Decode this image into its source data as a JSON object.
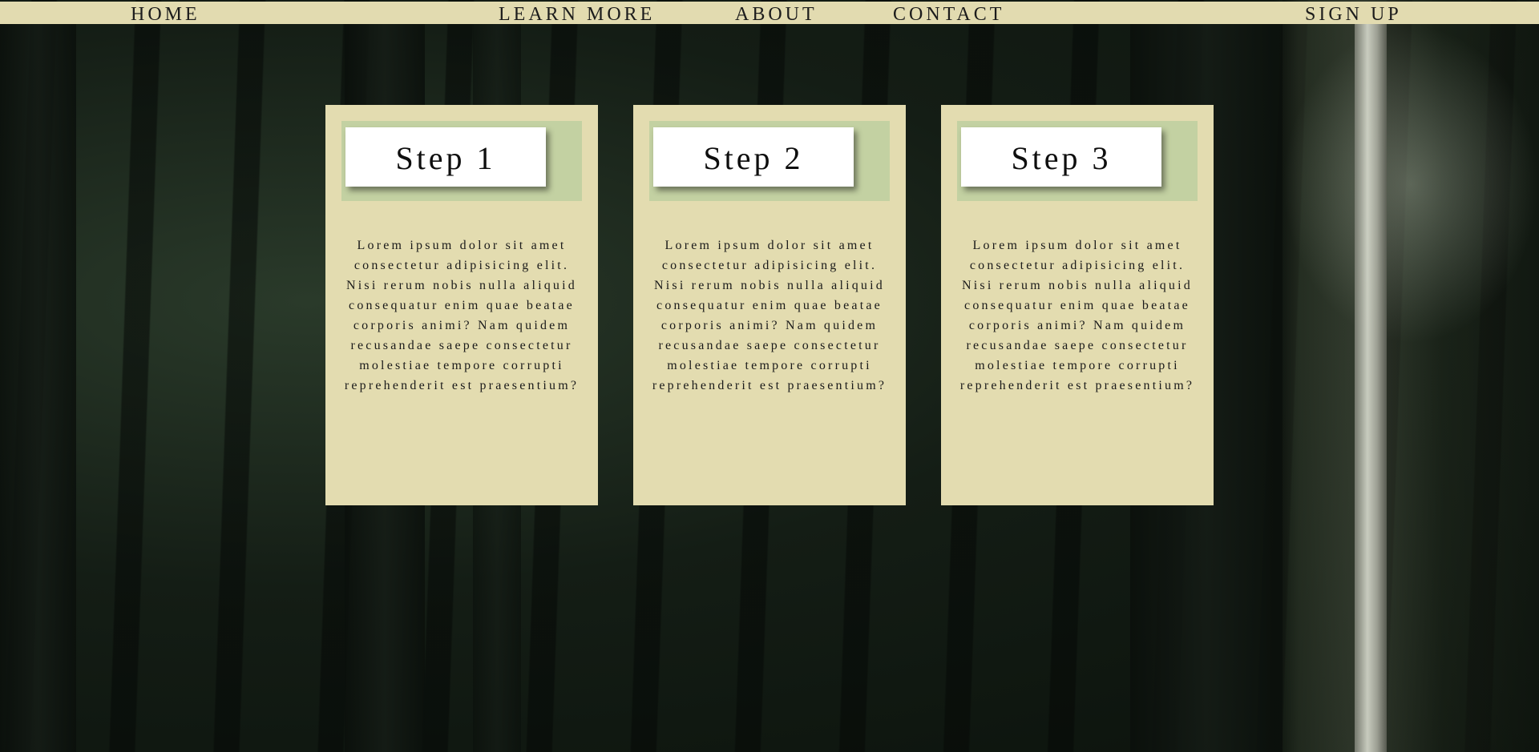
{
  "nav": {
    "home": "HOME",
    "learn_more": "LEARN MORE",
    "about": "ABOUT",
    "contact": "CONTACT",
    "sign_up": "SIGN UP"
  },
  "cards": [
    {
      "title": "Step 1",
      "body": "Lorem ipsum dolor sit amet consectetur adipisicing elit. Nisi rerum nobis nulla aliquid consequatur enim quae beatae corporis animi? Nam quidem recusandae saepe consectetur molestiae tempore corrupti reprehenderit est praesentium?"
    },
    {
      "title": "Step 2",
      "body": "Lorem ipsum dolor sit amet consectetur adipisicing elit. Nisi rerum nobis nulla aliquid consequatur enim quae beatae corporis animi? Nam quidem recusandae saepe consectetur molestiae tempore corrupti reprehenderit est praesentium?"
    },
    {
      "title": "Step 3",
      "body": "Lorem ipsum dolor sit amet consectetur adipisicing elit. Nisi rerum nobis nulla aliquid consequatur enim quae beatae corporis animi? Nam quidem recusandae saepe consectetur molestiae tempore corrupti reprehenderit est praesentium?"
    }
  ],
  "colors": {
    "nav_background": "#e2dbb0",
    "card_background": "#e3dcb0",
    "card_header_accent": "#c3d1a2",
    "title_box": "#ffffff"
  }
}
